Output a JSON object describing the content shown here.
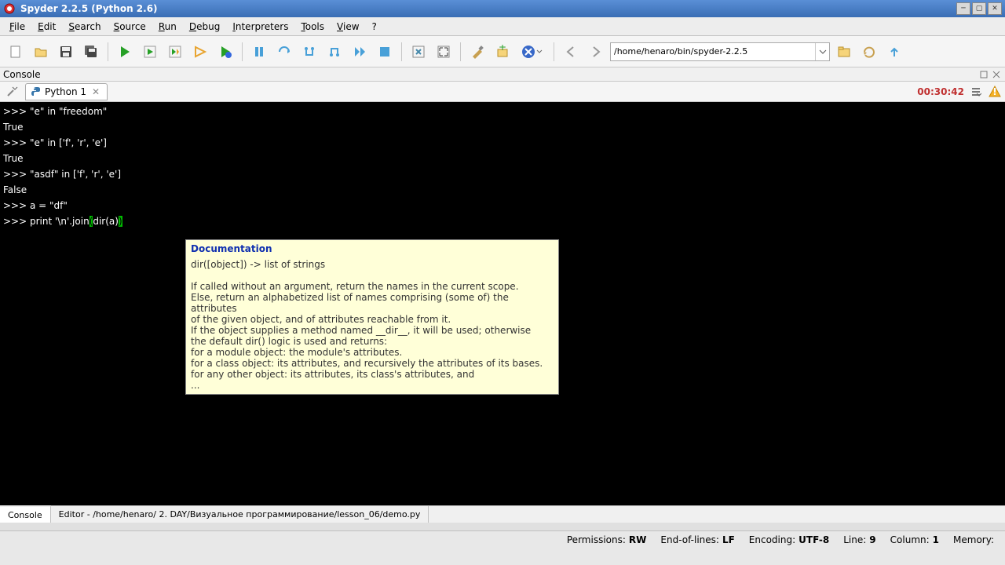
{
  "window": {
    "title": "Spyder 2.2.5 (Python 2.6)"
  },
  "menu": {
    "items": [
      "File",
      "Edit",
      "Search",
      "Source",
      "Run",
      "Debug",
      "Interpreters",
      "Tools",
      "View",
      "?"
    ]
  },
  "toolbar": {
    "path": "/home/henaro/bin/spyder-2.2.5"
  },
  "panel": {
    "title": "Console"
  },
  "tab": {
    "label": "Python 1",
    "timer": "00:30:42"
  },
  "console": {
    "l1p": ">>> ",
    "l1": "\"e\" in \"freedom\"",
    "l2": "True",
    "l3p": ">>> ",
    "l3": "\"e\" in ['f', 'r', 'e']",
    "l4": "True",
    "l5p": ">>> ",
    "l5": "\"asdf\" in ['f', 'r', 'e']",
    "l6": "False",
    "l7p": ">>> ",
    "l7": "a = \"df\"",
    "l8p": ">>> ",
    "l8a": "print '\\n'.join",
    "l8b": "(",
    "l8c": "dir(a)",
    "l8d": ")"
  },
  "tooltip": {
    "head": "Documentation",
    "body": "dir([object]) -> list of strings\n\nIf called without an argument, return the names in the current scope.\nElse, return an alphabetized list of names comprising (some of) the attributes\nof the given object, and of attributes reachable from it.\nIf the object supplies a method named __dir__, it will be used; otherwise\nthe default dir() logic is used and returns:\nfor a module object: the module's attributes.\nfor a class object: its attributes, and recursively the attributes of its bases.\nfor any other object: its attributes, its class's attributes, and\n..."
  },
  "bottom": {
    "tab1": "Console",
    "tab2": "Editor - /home/henaro/ 2. DAY/Визуальное программирование/lesson_06/demo.py"
  },
  "status": {
    "perm_l": "Permissions:",
    "perm_v": "RW",
    "eol_l": "End-of-lines:",
    "eol_v": "LF",
    "enc_l": "Encoding:",
    "enc_v": "UTF-8",
    "line_l": "Line:",
    "line_v": "9",
    "col_l": "Column:",
    "col_v": "1",
    "mem_l": "Memory:",
    "mem_v": ""
  }
}
